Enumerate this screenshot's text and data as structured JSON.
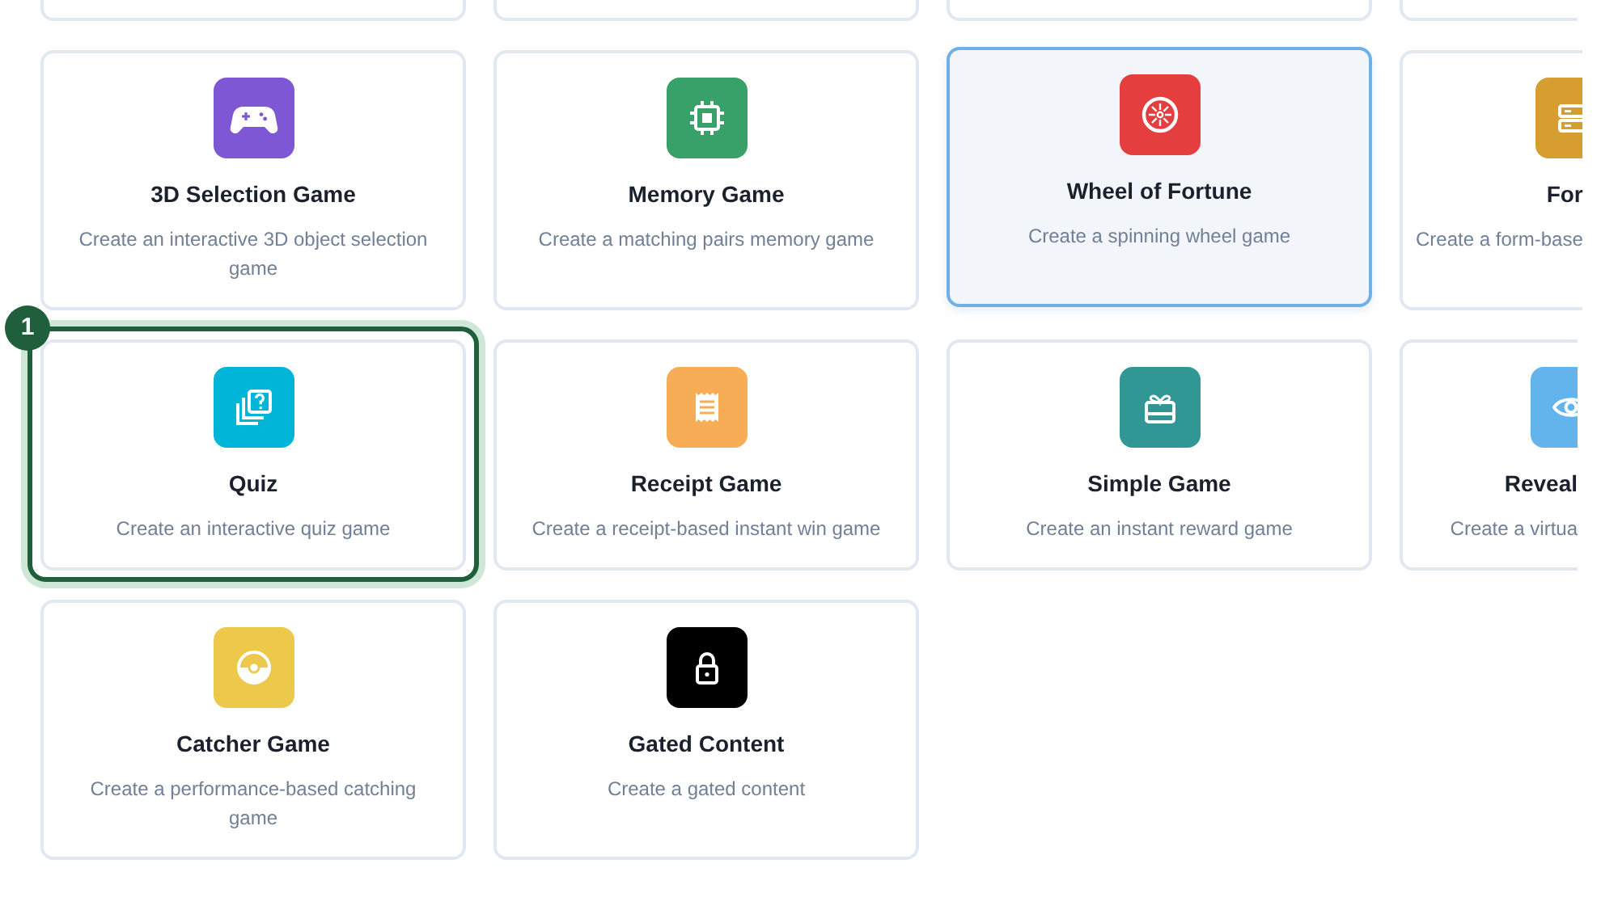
{
  "cards": [
    {
      "kind": "gamepad",
      "color": "#7e57d4",
      "title": "3D Selection Game",
      "description": "Create an interactive 3D object selection game",
      "selected": false,
      "highlighted": false
    },
    {
      "kind": "chip",
      "color": "#38a169",
      "title": "Memory Game",
      "description": "Create a matching pairs memory game",
      "selected": false,
      "highlighted": false
    },
    {
      "kind": "wheel",
      "color": "#e53e3e",
      "title": "Wheel of Fortune",
      "description": "Create a spinning wheel game",
      "selected": true,
      "highlighted": false
    },
    {
      "kind": "form",
      "color": "#d69e2e",
      "title": "For",
      "description": "Create a form-base",
      "selected": false,
      "highlighted": false
    },
    {
      "kind": "quiz",
      "color": "#00b5d8",
      "title": "Quiz",
      "description": "Create an interactive quiz game",
      "selected": false,
      "highlighted": true,
      "step_badge": "1"
    },
    {
      "kind": "receipt",
      "color": "#f6ad55",
      "title": "Receipt Game",
      "description": "Create a receipt-based instant win game",
      "selected": false,
      "highlighted": false
    },
    {
      "kind": "gift",
      "color": "#319795",
      "title": "Simple Game",
      "description": "Create an instant reward game",
      "selected": false,
      "highlighted": false
    },
    {
      "kind": "eye",
      "color": "#63b3ed",
      "title": "Reveal",
      "description": "Create a virtua",
      "selected": false,
      "highlighted": false
    },
    {
      "kind": "ball",
      "color": "#ecc94b",
      "title": "Catcher Game",
      "description": "Create a performance-based catching game",
      "selected": false,
      "highlighted": false
    },
    {
      "kind": "lock",
      "color": "#000000",
      "title": "Gated Content",
      "description": "Create a gated content",
      "selected": false,
      "highlighted": false
    }
  ]
}
